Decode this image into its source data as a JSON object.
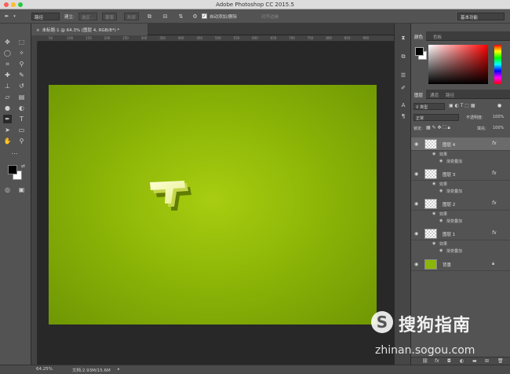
{
  "window": {
    "app_title": "Adobe Photoshop CC 2015.5"
  },
  "options_bar": {
    "tool_mode": "路径",
    "make_label": "建立:",
    "selection_btn": "选区...",
    "mask_btn": "蒙版",
    "shape_btn": "形状",
    "auto_add_delete": "自动添加/删除",
    "align_edges": "对齐边缘",
    "workspace": "基本功能"
  },
  "document": {
    "tab_title": "未标题-1 @ 64.3% (图层 4, RGB/8*) *",
    "ruler_ticks": [
      "50",
      "100",
      "150",
      "200",
      "250",
      "300",
      "350",
      "400",
      "450",
      "500",
      "550",
      "600",
      "650",
      "700",
      "750",
      "800",
      "850",
      "900"
    ],
    "canvas_color_center": "#a8cd10",
    "canvas_color_edge": "#6f9704"
  },
  "status": {
    "zoom": "64.25%",
    "doc_info": "文档:2.93M/15.6M"
  },
  "color_panel": {
    "tabs": [
      "颜色",
      "色板"
    ]
  },
  "layers_panel": {
    "tabs": [
      "图层",
      "通道",
      "路径"
    ],
    "kind_filter": "类型",
    "blend_mode": "正常",
    "opacity_label": "不透明度:",
    "opacity_value": "100%",
    "lock_label": "锁定:",
    "fill_label": "填充:",
    "fill_value": "100%",
    "effects_label": "效果",
    "gradient_overlay": "渐变叠加",
    "fx": "fx",
    "layers": [
      {
        "name": "图层 4"
      },
      {
        "name": "图层 3"
      },
      {
        "name": "图层 2"
      },
      {
        "name": "图层 1"
      },
      {
        "name": "背景"
      }
    ]
  },
  "watermark": {
    "brand_cn": "搜狗指南",
    "url": "zhinan.sogou.com"
  }
}
